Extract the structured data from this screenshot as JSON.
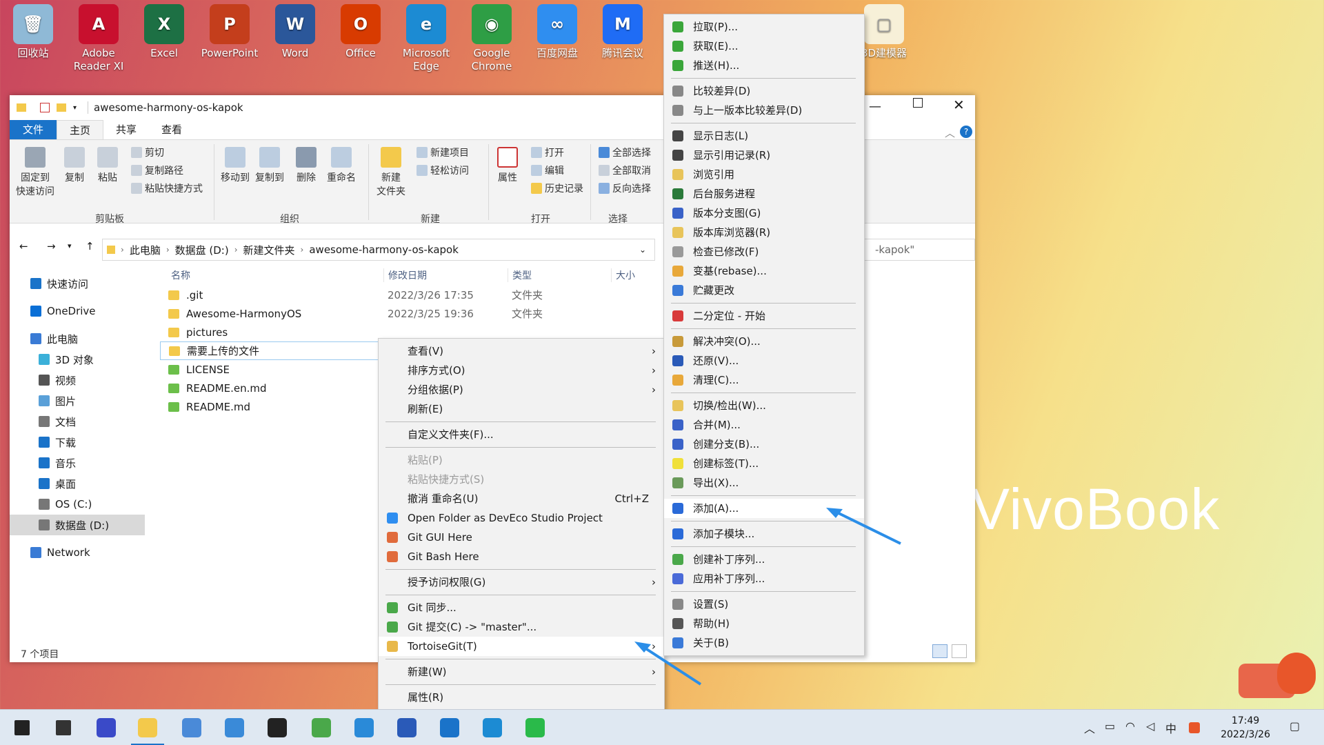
{
  "desktop": {
    "icons": [
      {
        "label": "回收站",
        "color": "#8fb9d6",
        "glyph": "🗑"
      },
      {
        "label": "Adobe Reader XI",
        "color": "#c8102e",
        "glyph": "A"
      },
      {
        "label": "Excel",
        "color": "#1d7044",
        "glyph": "X"
      },
      {
        "label": "PowerPoint",
        "color": "#c43e1c",
        "glyph": "P"
      },
      {
        "label": "Word",
        "color": "#2b579a",
        "glyph": "W"
      },
      {
        "label": "Office",
        "color": "#d83b01",
        "glyph": "O"
      },
      {
        "label": "Microsoft Edge",
        "color": "#1c8bd3",
        "glyph": "e"
      },
      {
        "label": "Google Chrome",
        "color": "#2e9e45",
        "glyph": "◉"
      },
      {
        "label": "百度网盘",
        "color": "#2f8ef0",
        "glyph": "∞"
      },
      {
        "label": "腾讯会议",
        "color": "#1f6cf5",
        "glyph": "M"
      }
    ],
    "partial_label": "3D建模器",
    "brand_text": "VivoBook"
  },
  "explorer": {
    "title": "awesome-harmony-os-kapok",
    "tabs": [
      "文件",
      "主页",
      "共享",
      "查看"
    ],
    "ribbon": {
      "pin": "固定到\n快速访问",
      "copy": "复制",
      "paste": "粘贴",
      "cut": "剪切",
      "copy_path": "复制路径",
      "paste_shortcut": "粘贴快捷方式",
      "clipboard_group": "剪贴板",
      "move_to": "移动到",
      "copy_to": "复制到",
      "delete": "删除",
      "rename": "重命名",
      "organize_group": "组织",
      "new_folder": "新建\n文件夹",
      "new_item": "新建项目",
      "easy_access": "轻松访问",
      "new_group": "新建",
      "properties": "属性",
      "open": "打开",
      "edit": "编辑",
      "history": "历史记录",
      "open_group": "打开",
      "select_all": "全部选择",
      "select_none": "全部取消",
      "invert": "反向选择",
      "select_group": "选择"
    },
    "breadcrumb": [
      "此电脑",
      "数据盘 (D:)",
      "新建文件夹",
      "awesome-harmony-os-kapok"
    ],
    "search_partial": "-kapok\"",
    "nav": [
      {
        "label": "快速访问",
        "indent": 0,
        "color": "#1a73c9"
      },
      {
        "label": "OneDrive",
        "indent": 0,
        "color": "#0a6fd6"
      },
      {
        "label": "此电脑",
        "indent": 0,
        "color": "#3a7bd5"
      },
      {
        "label": "3D 对象",
        "indent": 1,
        "color": "#3bb0d9"
      },
      {
        "label": "视频",
        "indent": 1,
        "color": "#555"
      },
      {
        "label": "图片",
        "indent": 1,
        "color": "#5aa0d8"
      },
      {
        "label": "文档",
        "indent": 1,
        "color": "#777"
      },
      {
        "label": "下载",
        "indent": 1,
        "color": "#1a73c9"
      },
      {
        "label": "音乐",
        "indent": 1,
        "color": "#1a73c9"
      },
      {
        "label": "桌面",
        "indent": 1,
        "color": "#1a73c9"
      },
      {
        "label": "OS (C:)",
        "indent": 1,
        "color": "#777"
      },
      {
        "label": "数据盘 (D:)",
        "indent": 1,
        "color": "#777"
      },
      {
        "label": "Network",
        "indent": 0,
        "color": "#3a7bd5"
      }
    ],
    "columns": [
      "名称",
      "修改日期",
      "类型",
      "大小"
    ],
    "files": [
      {
        "name": ".git",
        "date": "2022/3/26 17:35",
        "type": "文件夹",
        "icon": "#f3c94b"
      },
      {
        "name": "Awesome-HarmonyOS",
        "date": "2022/3/25 19:36",
        "type": "文件夹",
        "icon": "#f3c94b"
      },
      {
        "name": "pictures",
        "date": "",
        "type": "",
        "icon": "#f3c94b"
      },
      {
        "name": "需要上传的文件",
        "date": "",
        "type": "",
        "icon": "#f3c94b"
      },
      {
        "name": "LICENSE",
        "date": "",
        "type": "",
        "icon": "#6cbf4a"
      },
      {
        "name": "README.en.md",
        "date": "",
        "type": "",
        "icon": "#6cbf4a"
      },
      {
        "name": "README.md",
        "date": "",
        "type": "",
        "icon": "#6cbf4a"
      }
    ],
    "status": "7 个项目"
  },
  "context_menu": [
    {
      "label": "查看(V)",
      "arrow": true
    },
    {
      "label": "排序方式(O)",
      "arrow": true
    },
    {
      "label": "分组依据(P)",
      "arrow": true
    },
    {
      "label": "刷新(E)"
    },
    {
      "sep": true
    },
    {
      "label": "自定义文件夹(F)..."
    },
    {
      "sep": true
    },
    {
      "label": "粘贴(P)",
      "disabled": true
    },
    {
      "label": "粘贴快捷方式(S)",
      "disabled": true
    },
    {
      "label": "撤消 重命名(U)",
      "shortcut": "Ctrl+Z"
    },
    {
      "label": "Open Folder as DevEco Studio Project",
      "icon": "#2f8ef0"
    },
    {
      "label": "Git GUI Here",
      "icon": "#e06b3c"
    },
    {
      "label": "Git Bash Here",
      "icon": "#e06b3c"
    },
    {
      "sep": true
    },
    {
      "label": "授予访问权限(G)",
      "arrow": true
    },
    {
      "sep": true
    },
    {
      "label": "Git 同步...",
      "icon": "#4aa84a"
    },
    {
      "label": "Git 提交(C) -> \"master\"...",
      "icon": "#4aa84a"
    },
    {
      "label": "TortoiseGit(T)",
      "arrow": true,
      "icon": "#e8b84a",
      "highlight": true
    },
    {
      "sep": true
    },
    {
      "label": "新建(W)",
      "arrow": true
    },
    {
      "sep": true
    },
    {
      "label": "属性(R)"
    }
  ],
  "tortoise_menu": [
    {
      "label": "拉取(P)...",
      "icon": "#3aa63a"
    },
    {
      "label": "获取(E)...",
      "icon": "#3aa63a"
    },
    {
      "label": "推送(H)...",
      "icon": "#3aa63a"
    },
    {
      "sep": true
    },
    {
      "label": "比较差异(D)",
      "icon": "#888"
    },
    {
      "label": "与上一版本比较差异(D)",
      "icon": "#888"
    },
    {
      "sep": true
    },
    {
      "label": "显示日志(L)",
      "icon": "#444"
    },
    {
      "label": "显示引用记录(R)",
      "icon": "#444"
    },
    {
      "label": "浏览引用",
      "icon": "#e8c45a"
    },
    {
      "label": "后台服务进程",
      "icon": "#2a7a3a"
    },
    {
      "label": "版本分支图(G)",
      "icon": "#3a62c8"
    },
    {
      "label": "版本库浏览器(R)",
      "icon": "#e8c45a"
    },
    {
      "label": "检查已修改(F)",
      "icon": "#999"
    },
    {
      "label": "变基(rebase)...",
      "icon": "#e8a83a"
    },
    {
      "label": "贮藏更改",
      "icon": "#3a7ad8"
    },
    {
      "sep": true
    },
    {
      "label": "二分定位 - 开始",
      "icon": "#d83a3a"
    },
    {
      "sep": true
    },
    {
      "label": "解决冲突(O)...",
      "icon": "#c89a3a"
    },
    {
      "label": "还原(V)...",
      "icon": "#2a5ab8"
    },
    {
      "label": "清理(C)...",
      "icon": "#e8a83a"
    },
    {
      "sep": true
    },
    {
      "label": "切换/检出(W)...",
      "icon": "#e8c45a"
    },
    {
      "label": "合并(M)...",
      "icon": "#3a62c8"
    },
    {
      "label": "创建分支(B)...",
      "icon": "#3a62c8"
    },
    {
      "label": "创建标签(T)...",
      "icon": "#f0e03a"
    },
    {
      "label": "导出(X)...",
      "icon": "#6a9a5a"
    },
    {
      "sep": true
    },
    {
      "label": "添加(A)...",
      "icon": "#2a6ad8",
      "highlight": true
    },
    {
      "sep": true
    },
    {
      "label": "添加子模块...",
      "icon": "#2a6ad8"
    },
    {
      "sep": true
    },
    {
      "label": "创建补丁序列...",
      "icon": "#4aa84a"
    },
    {
      "label": "应用补丁序列...",
      "icon": "#4a6ad8"
    },
    {
      "sep": true
    },
    {
      "label": "设置(S)",
      "icon": "#888"
    },
    {
      "label": "帮助(H)",
      "icon": "#555"
    },
    {
      "label": "关于(B)",
      "icon": "#3a7ad8"
    }
  ],
  "taskbar": {
    "time": "17:49",
    "date": "2022/3/26",
    "ime": "中",
    "apps": [
      {
        "name": "start",
        "color": "#222"
      },
      {
        "name": "search",
        "color": "#333"
      },
      {
        "name": "deveco",
        "color": "#3a4ac8"
      },
      {
        "name": "file-explorer",
        "color": "#f3c94b"
      },
      {
        "name": "this-pc",
        "color": "#4a8ad8"
      },
      {
        "name": "control",
        "color": "#3a8ad8"
      },
      {
        "name": "terminal",
        "color": "#222"
      },
      {
        "name": "cube-app",
        "color": "#4aa84a"
      },
      {
        "name": "app-a",
        "color": "#2a8ad8"
      },
      {
        "name": "wps",
        "color": "#2a5ab8"
      },
      {
        "name": "k-app",
        "color": "#1a73c9"
      },
      {
        "name": "edge",
        "color": "#1c8bd3"
      },
      {
        "name": "wechat",
        "color": "#2aba4a"
      }
    ]
  }
}
